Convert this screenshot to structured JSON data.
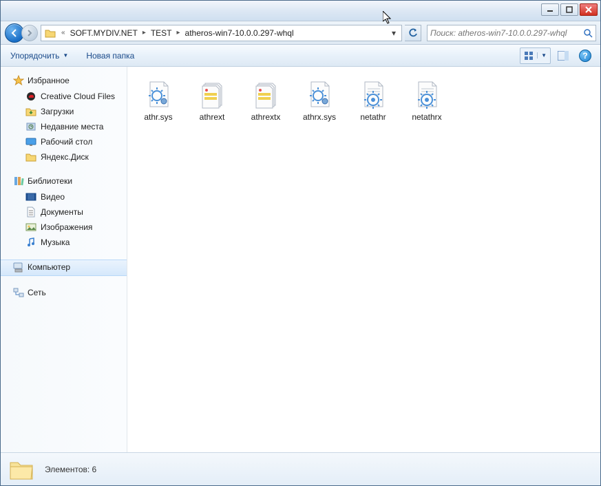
{
  "breadcrumb": {
    "seg1": "SOFT.MYDIV.NET",
    "seg2": "TEST",
    "seg3": "atheros-win7-10.0.0.297-whql"
  },
  "search": {
    "placeholder": "Поиск: atheros-win7-10.0.0.297-whql"
  },
  "toolbar": {
    "organize": "Упорядочить",
    "new_folder": "Новая папка"
  },
  "sidebar": {
    "favorites": {
      "header": "Избранное",
      "items": [
        "Creative Cloud Files",
        "Загрузки",
        "Недавние места",
        "Рабочий стол",
        "Яндекс.Диск"
      ]
    },
    "libraries": {
      "header": "Библиотеки",
      "items": [
        "Видео",
        "Документы",
        "Изображения",
        "Музыка"
      ]
    },
    "computer": "Компьютер",
    "network": "Сеть"
  },
  "files": [
    {
      "name": "athr.sys",
      "type": "sys"
    },
    {
      "name": "athrext",
      "type": "cat"
    },
    {
      "name": "athrextx",
      "type": "cat"
    },
    {
      "name": "athrx.sys",
      "type": "sys"
    },
    {
      "name": "netathr",
      "type": "inf"
    },
    {
      "name": "netathrx",
      "type": "inf"
    }
  ],
  "status": {
    "label": "Элементов: 6"
  }
}
